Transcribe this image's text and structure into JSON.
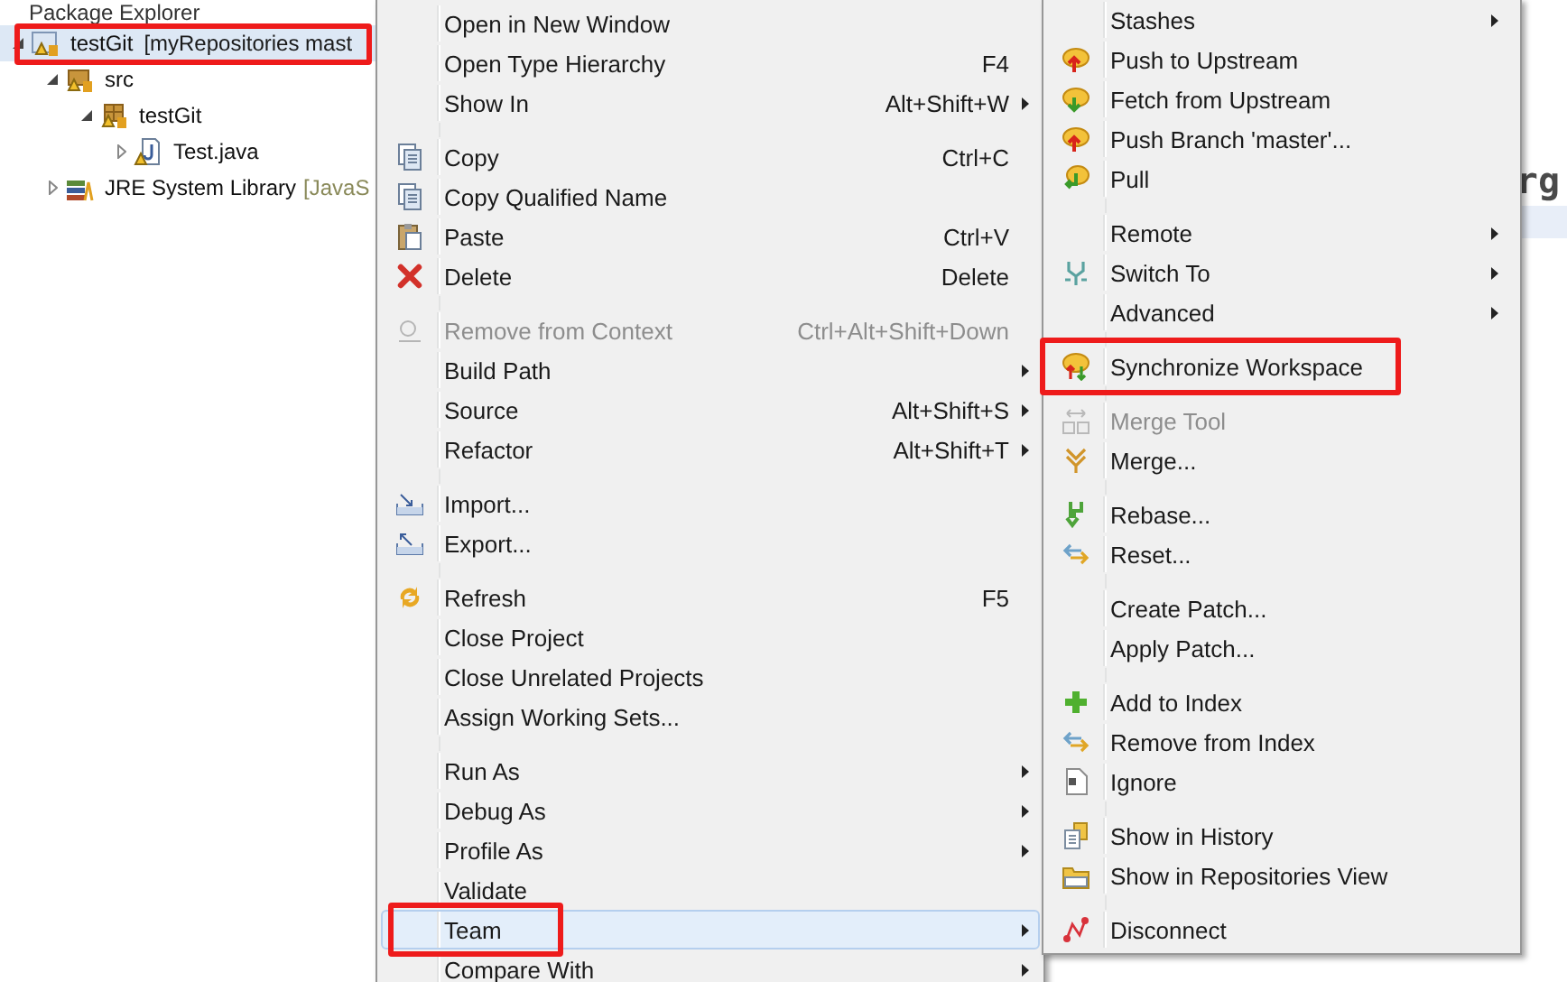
{
  "explorer": {
    "title": "Package Explorer",
    "tree": [
      {
        "label": "testGit",
        "decoration": "[myRepositories mast",
        "expanded": true,
        "selected": true,
        "highlighted": true,
        "children": [
          {
            "label": "src",
            "expanded": true,
            "selected": false,
            "highlighted": false,
            "children": [
              {
                "label": "testGit",
                "expanded": true,
                "selected": false,
                "highlighted": false,
                "children": [
                  {
                    "label": "Test.java",
                    "expanded": false,
                    "selected": false,
                    "highlighted": false
                  }
                ]
              }
            ]
          },
          {
            "label": "JRE System Library",
            "decoration": "[JavaS",
            "expanded": false,
            "selected": false,
            "highlighted": false
          }
        ]
      }
    ]
  },
  "editor": {
    "code_fragment": "rg"
  },
  "context_menu": {
    "groups": [
      [
        {
          "label": "Open in New Window",
          "disabled": false,
          "selected": false,
          "highlighted": false,
          "submenu": false
        },
        {
          "label": "Open Type Hierarchy",
          "shortcut": "F4",
          "disabled": false,
          "selected": false,
          "highlighted": false,
          "submenu": false
        },
        {
          "label": "Show In",
          "shortcut": "Alt+Shift+W",
          "disabled": false,
          "selected": false,
          "highlighted": false,
          "submenu": true
        }
      ],
      [
        {
          "label": "Copy",
          "shortcut": "Ctrl+C",
          "disabled": false,
          "selected": false,
          "highlighted": false,
          "submenu": false
        },
        {
          "label": "Copy Qualified Name",
          "disabled": false,
          "selected": false,
          "highlighted": false,
          "submenu": false
        },
        {
          "label": "Paste",
          "shortcut": "Ctrl+V",
          "disabled": false,
          "selected": false,
          "highlighted": false,
          "submenu": false
        },
        {
          "label": "Delete",
          "shortcut": "Delete",
          "disabled": false,
          "selected": false,
          "highlighted": false,
          "submenu": false
        }
      ],
      [
        {
          "label": "Remove from Context",
          "shortcut": "Ctrl+Alt+Shift+Down",
          "disabled": true,
          "selected": false,
          "highlighted": false,
          "submenu": false
        },
        {
          "label": "Build Path",
          "disabled": false,
          "selected": false,
          "highlighted": false,
          "submenu": true
        },
        {
          "label": "Source",
          "shortcut": "Alt+Shift+S",
          "disabled": false,
          "selected": false,
          "highlighted": false,
          "submenu": true
        },
        {
          "label": "Refactor",
          "shortcut": "Alt+Shift+T",
          "disabled": false,
          "selected": false,
          "highlighted": false,
          "submenu": true
        }
      ],
      [
        {
          "label": "Import...",
          "disabled": false,
          "selected": false,
          "highlighted": false,
          "submenu": false
        },
        {
          "label": "Export...",
          "disabled": false,
          "selected": false,
          "highlighted": false,
          "submenu": false
        }
      ],
      [
        {
          "label": "Refresh",
          "shortcut": "F5",
          "disabled": false,
          "selected": false,
          "highlighted": false,
          "submenu": false
        },
        {
          "label": "Close Project",
          "disabled": false,
          "selected": false,
          "highlighted": false,
          "submenu": false
        },
        {
          "label": "Close Unrelated Projects",
          "disabled": false,
          "selected": false,
          "highlighted": false,
          "submenu": false
        },
        {
          "label": "Assign Working Sets...",
          "disabled": false,
          "selected": false,
          "highlighted": false,
          "submenu": false
        }
      ],
      [
        {
          "label": "Run As",
          "disabled": false,
          "selected": false,
          "highlighted": false,
          "submenu": true
        },
        {
          "label": "Debug As",
          "disabled": false,
          "selected": false,
          "highlighted": false,
          "submenu": true
        },
        {
          "label": "Profile As",
          "disabled": false,
          "selected": false,
          "highlighted": false,
          "submenu": true
        },
        {
          "label": "Validate",
          "disabled": false,
          "selected": false,
          "highlighted": false,
          "submenu": false
        },
        {
          "label": "Team",
          "disabled": false,
          "selected": true,
          "highlighted": true,
          "submenu": true
        },
        {
          "label": "Compare With",
          "disabled": false,
          "selected": false,
          "highlighted": false,
          "submenu": true
        }
      ]
    ]
  },
  "team_submenu": {
    "groups": [
      [
        {
          "label": "Stashes",
          "disabled": false,
          "selected": false,
          "highlighted": false,
          "submenu": true
        },
        {
          "label": "Push to Upstream",
          "disabled": false,
          "selected": false,
          "highlighted": false,
          "submenu": false
        },
        {
          "label": "Fetch from Upstream",
          "disabled": false,
          "selected": false,
          "highlighted": false,
          "submenu": false
        },
        {
          "label": "Push Branch 'master'...",
          "disabled": false,
          "selected": false,
          "highlighted": false,
          "submenu": false
        },
        {
          "label": "Pull",
          "disabled": false,
          "selected": false,
          "highlighted": false,
          "submenu": false
        }
      ],
      [
        {
          "label": "Remote",
          "disabled": false,
          "selected": false,
          "highlighted": false,
          "submenu": true
        },
        {
          "label": "Switch To",
          "disabled": false,
          "selected": false,
          "highlighted": false,
          "submenu": true
        },
        {
          "label": "Advanced",
          "disabled": false,
          "selected": false,
          "highlighted": false,
          "submenu": true
        }
      ],
      [
        {
          "label": "Synchronize Workspace",
          "disabled": false,
          "selected": false,
          "highlighted": true,
          "submenu": false
        }
      ],
      [
        {
          "label": "Merge Tool",
          "disabled": true,
          "selected": false,
          "highlighted": false,
          "submenu": false
        },
        {
          "label": "Merge...",
          "disabled": false,
          "selected": false,
          "highlighted": false,
          "submenu": false
        }
      ],
      [
        {
          "label": "Rebase...",
          "disabled": false,
          "selected": false,
          "highlighted": false,
          "submenu": false
        },
        {
          "label": "Reset...",
          "disabled": false,
          "selected": false,
          "highlighted": false,
          "submenu": false
        }
      ],
      [
        {
          "label": "Create Patch...",
          "disabled": false,
          "selected": false,
          "highlighted": false,
          "submenu": false
        },
        {
          "label": "Apply Patch...",
          "disabled": false,
          "selected": false,
          "highlighted": false,
          "submenu": false
        }
      ],
      [
        {
          "label": "Add to Index",
          "disabled": false,
          "selected": false,
          "highlighted": false,
          "submenu": false
        },
        {
          "label": "Remove from Index",
          "disabled": false,
          "selected": false,
          "highlighted": false,
          "submenu": false
        },
        {
          "label": "Ignore",
          "disabled": false,
          "selected": false,
          "highlighted": false,
          "submenu": false
        }
      ],
      [
        {
          "label": "Show in History",
          "disabled": false,
          "selected": false,
          "highlighted": false,
          "submenu": false
        },
        {
          "label": "Show in Repositories View",
          "disabled": false,
          "selected": false,
          "highlighted": false,
          "submenu": false
        }
      ],
      [
        {
          "label": "Disconnect",
          "disabled": false,
          "selected": false,
          "highlighted": false,
          "submenu": false
        }
      ]
    ]
  }
}
